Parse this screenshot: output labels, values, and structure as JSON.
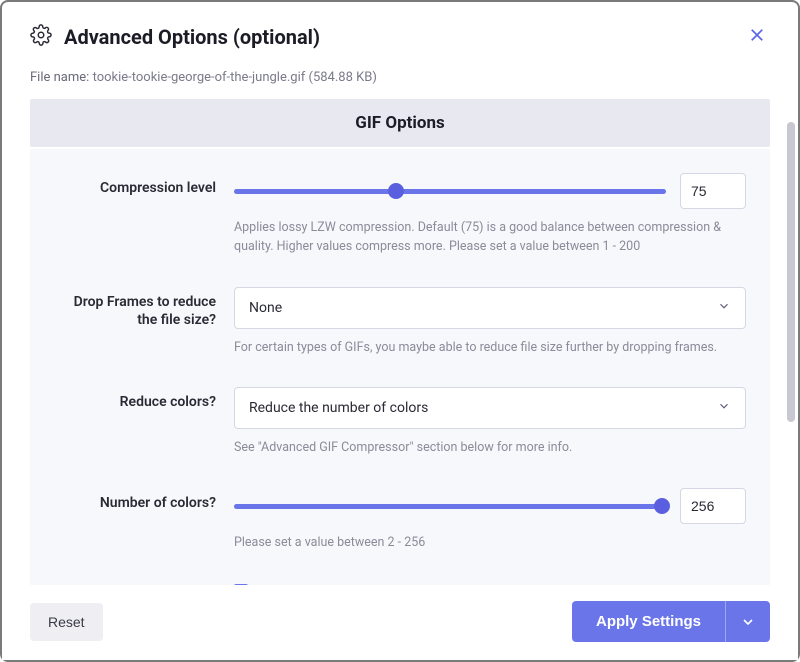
{
  "header": {
    "title": "Advanced Options (optional)"
  },
  "file": {
    "label": "File name:",
    "name": "tookie-tookie-george-of-the-jungle.gif (584.88 KB)"
  },
  "section": {
    "title": "GIF Options"
  },
  "options": {
    "compression": {
      "label": "Compression level",
      "value": "75",
      "fill_pct": 37.5,
      "thumb_pct": 37.5,
      "help": "Applies lossy LZW compression. Default (75) is a good balance between compression & quality. Higher values compress more. Please set a value between 1 - 200"
    },
    "drop_frames": {
      "label": "Drop Frames to reduce the file size?",
      "value": "None",
      "help": "For certain types of GIFs, you maybe able to reduce file size further by dropping frames."
    },
    "reduce_colors": {
      "label": "Reduce colors?",
      "value": "Reduce the number of colors",
      "help": "See \"Advanced GIF Compressor\" section below for more info."
    },
    "num_colors": {
      "label": "Number of colors?",
      "value": "256",
      "fill_pct": 100,
      "thumb_pct": 100,
      "help": "Please set a value between 2 - 256"
    }
  },
  "footer": {
    "reset": "Reset",
    "apply": "Apply Settings"
  }
}
